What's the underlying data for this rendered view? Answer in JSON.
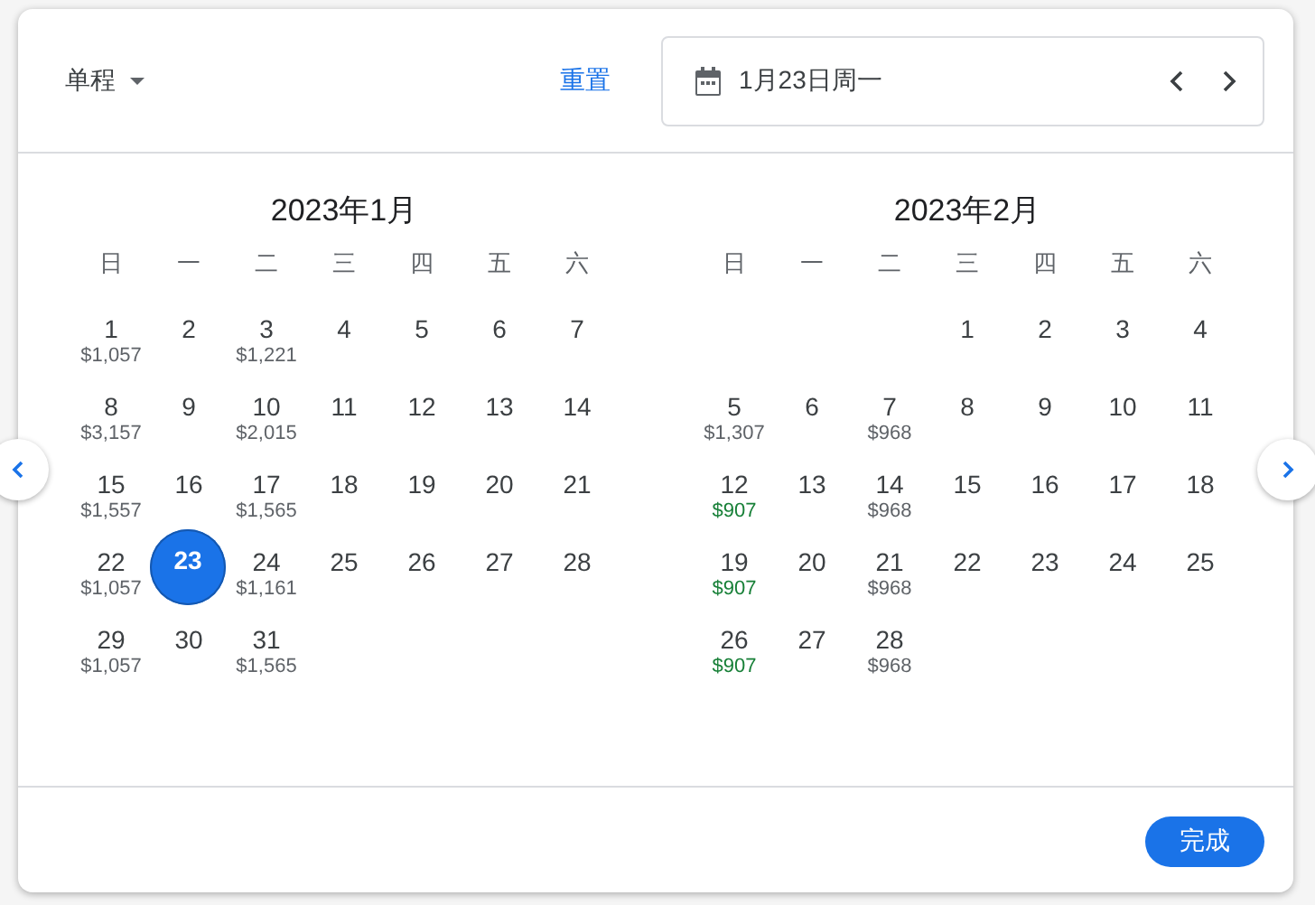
{
  "header": {
    "trip_type": "单程",
    "reset": "重置",
    "date_field": {
      "value": "1月23日周一"
    }
  },
  "months": [
    {
      "title": "2023年1月",
      "weekdays": [
        "日",
        "一",
        "二",
        "三",
        "四",
        "五",
        "六"
      ],
      "days": [
        {
          "kind": "day",
          "day": "1",
          "price": "$1,057",
          "color": "#5f6368",
          "selected": false
        },
        {
          "kind": "day",
          "day": "2",
          "selected": false
        },
        {
          "kind": "day",
          "day": "3",
          "price": "$1,221",
          "color": "#5f6368",
          "selected": false
        },
        {
          "kind": "day",
          "day": "4",
          "selected": false
        },
        {
          "kind": "day",
          "day": "5",
          "selected": false
        },
        {
          "kind": "day",
          "day": "6",
          "selected": false
        },
        {
          "kind": "day",
          "day": "7",
          "selected": false
        },
        {
          "kind": "day",
          "day": "8",
          "price": "$3,157",
          "color": "#5f6368",
          "selected": false
        },
        {
          "kind": "day",
          "day": "9",
          "selected": false
        },
        {
          "kind": "day",
          "day": "10",
          "price": "$2,015",
          "color": "#5f6368",
          "selected": false
        },
        {
          "kind": "day",
          "day": "11",
          "selected": false
        },
        {
          "kind": "day",
          "day": "12",
          "selected": false
        },
        {
          "kind": "day",
          "day": "13",
          "selected": false
        },
        {
          "kind": "day",
          "day": "14",
          "selected": false
        },
        {
          "kind": "day",
          "day": "15",
          "price": "$1,557",
          "color": "#5f6368",
          "selected": false
        },
        {
          "kind": "day",
          "day": "16",
          "selected": false
        },
        {
          "kind": "day",
          "day": "17",
          "price": "$1,565",
          "color": "#5f6368",
          "selected": false
        },
        {
          "kind": "day",
          "day": "18",
          "selected": false
        },
        {
          "kind": "day",
          "day": "19",
          "selected": false
        },
        {
          "kind": "day",
          "day": "20",
          "selected": false
        },
        {
          "kind": "day",
          "day": "21",
          "selected": false
        },
        {
          "kind": "day",
          "day": "22",
          "price": "$1,057",
          "color": "#5f6368",
          "selected": false
        },
        {
          "kind": "day",
          "day": "23",
          "selected": true
        },
        {
          "kind": "day",
          "day": "24",
          "price": "$1,161",
          "color": "#5f6368",
          "selected": false
        },
        {
          "kind": "day",
          "day": "25",
          "selected": false
        },
        {
          "kind": "day",
          "day": "26",
          "selected": false
        },
        {
          "kind": "day",
          "day": "27",
          "selected": false
        },
        {
          "kind": "day",
          "day": "28",
          "selected": false
        },
        {
          "kind": "day",
          "day": "29",
          "price": "$1,057",
          "color": "#5f6368",
          "selected": false
        },
        {
          "kind": "day",
          "day": "30",
          "selected": false
        },
        {
          "kind": "day",
          "day": "31",
          "price": "$1,565",
          "color": "#5f6368",
          "selected": false
        }
      ]
    },
    {
      "title": "2023年2月",
      "weekdays": [
        "日",
        "一",
        "二",
        "三",
        "四",
        "五",
        "六"
      ],
      "days": [
        {
          "kind": "blank"
        },
        {
          "kind": "blank"
        },
        {
          "kind": "blank"
        },
        {
          "kind": "day",
          "day": "1",
          "selected": false
        },
        {
          "kind": "day",
          "day": "2",
          "selected": false
        },
        {
          "kind": "day",
          "day": "3",
          "selected": false
        },
        {
          "kind": "day",
          "day": "4",
          "selected": false
        },
        {
          "kind": "day",
          "day": "5",
          "price": "$1,307",
          "color": "#5f6368",
          "selected": false
        },
        {
          "kind": "day",
          "day": "6",
          "selected": false
        },
        {
          "kind": "day",
          "day": "7",
          "price": "$968",
          "color": "#5f6368",
          "selected": false
        },
        {
          "kind": "day",
          "day": "8",
          "selected": false
        },
        {
          "kind": "day",
          "day": "9",
          "selected": false
        },
        {
          "kind": "day",
          "day": "10",
          "selected": false
        },
        {
          "kind": "day",
          "day": "11",
          "selected": false
        },
        {
          "kind": "day",
          "day": "12",
          "price": "$907",
          "color": "#188038",
          "selected": false
        },
        {
          "kind": "day",
          "day": "13",
          "selected": false
        },
        {
          "kind": "day",
          "day": "14",
          "price": "$968",
          "color": "#5f6368",
          "selected": false
        },
        {
          "kind": "day",
          "day": "15",
          "selected": false
        },
        {
          "kind": "day",
          "day": "16",
          "selected": false
        },
        {
          "kind": "day",
          "day": "17",
          "selected": false
        },
        {
          "kind": "day",
          "day": "18",
          "selected": false
        },
        {
          "kind": "day",
          "day": "19",
          "price": "$907",
          "color": "#188038",
          "selected": false
        },
        {
          "kind": "day",
          "day": "20",
          "selected": false
        },
        {
          "kind": "day",
          "day": "21",
          "price": "$968",
          "color": "#5f6368",
          "selected": false
        },
        {
          "kind": "day",
          "day": "22",
          "selected": false
        },
        {
          "kind": "day",
          "day": "23",
          "selected": false
        },
        {
          "kind": "day",
          "day": "24",
          "selected": false
        },
        {
          "kind": "day",
          "day": "25",
          "selected": false
        },
        {
          "kind": "day",
          "day": "26",
          "price": "$907",
          "color": "#188038",
          "selected": false
        },
        {
          "kind": "day",
          "day": "27",
          "selected": false
        },
        {
          "kind": "day",
          "day": "28",
          "price": "$968",
          "color": "#5f6368",
          "selected": false
        }
      ]
    }
  ],
  "footer": {
    "done": "完成"
  }
}
